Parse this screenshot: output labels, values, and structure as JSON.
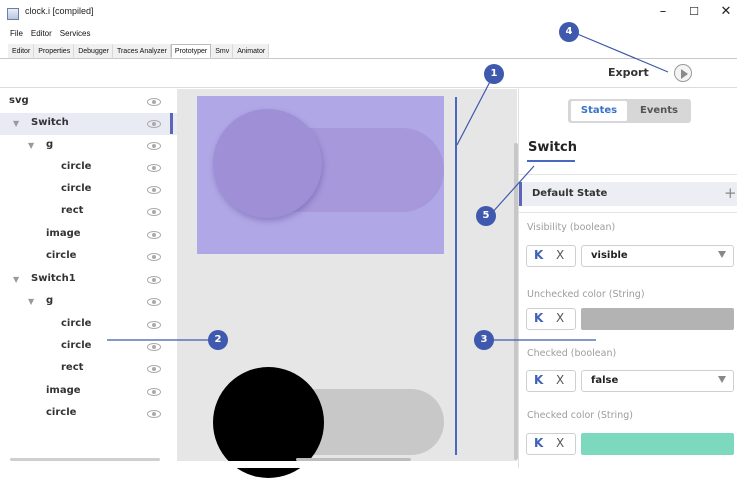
{
  "window": {
    "title": "clock.i [compiled]",
    "minimize": "–",
    "maximize": "☐",
    "close": "✕"
  },
  "menu": [
    "File",
    "Editor",
    "Services"
  ],
  "tabs": [
    {
      "label": "Editor",
      "active": false
    },
    {
      "label": "Properties",
      "active": false
    },
    {
      "label": "Debugger",
      "active": false
    },
    {
      "label": "Traces Analyzer",
      "active": false
    },
    {
      "label": "Prototyper",
      "active": true
    },
    {
      "label": "Smv",
      "active": false
    },
    {
      "label": "Animator",
      "active": false
    }
  ],
  "toolbar": {
    "export_label": "Export",
    "play_icon": "play-icon"
  },
  "tree": [
    {
      "label": "svg",
      "caret": ""
    },
    {
      "label": "Switch",
      "caret": "▼",
      "selected": true
    },
    {
      "label": "g",
      "caret": "▼"
    },
    {
      "label": "circle",
      "caret": ""
    },
    {
      "label": "circle",
      "caret": ""
    },
    {
      "label": "rect",
      "caret": ""
    },
    {
      "label": "image",
      "caret": ""
    },
    {
      "label": "circle",
      "caret": ""
    },
    {
      "label": "Switch1",
      "caret": "▼"
    },
    {
      "label": "g",
      "caret": "▼"
    },
    {
      "label": "circle",
      "caret": ""
    },
    {
      "label": "circle",
      "caret": ""
    },
    {
      "label": "rect",
      "caret": ""
    },
    {
      "label": "image",
      "caret": ""
    },
    {
      "label": "circle",
      "caret": ""
    }
  ],
  "panel": {
    "seg_states": "States",
    "seg_events": "Events",
    "component_title": "Switch",
    "default_state": "Default State",
    "add": "+",
    "props": [
      {
        "label": "Visibility (boolean)",
        "k": "K",
        "x": "X",
        "value": "visible",
        "kind": "dropdown"
      },
      {
        "label": "Unchecked color (String)",
        "k": "K",
        "x": "X",
        "color": "#b3b3b3",
        "kind": "color"
      },
      {
        "label": "Checked (boolean)",
        "k": "K",
        "x": "X",
        "value": "false",
        "kind": "dropdown"
      },
      {
        "label": "Checked color (String)",
        "k": "K",
        "x": "X",
        "color": "#7dd9bd",
        "kind": "color"
      }
    ]
  },
  "callouts": [
    "1",
    "2",
    "3",
    "4",
    "5"
  ],
  "colors": {
    "accent": "#3e59ad",
    "selection_bar": "#5b66b9",
    "svg_bg": "#b0a7e6",
    "track1": "#a698db",
    "knob1": "#9f8fd7",
    "track2": "#c8c8c8",
    "knob2": "#000000"
  }
}
